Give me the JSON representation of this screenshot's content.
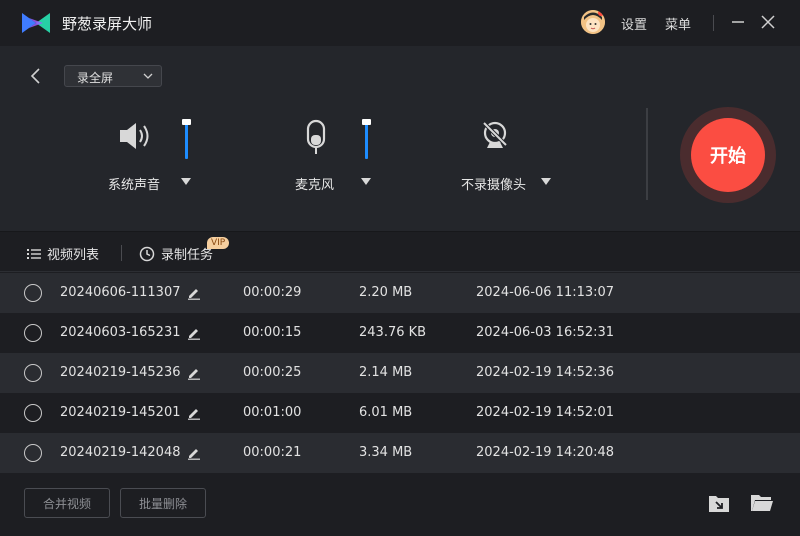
{
  "app": {
    "title": "野葱录屏大师"
  },
  "header": {
    "settings_label": "设置",
    "menu_label": "菜单"
  },
  "controls": {
    "mode": "录全屏",
    "system_audio": {
      "label": "系统声音",
      "volume": 1.0
    },
    "microphone": {
      "label": "麦克风",
      "volume": 1.0
    },
    "camera": {
      "label": "不录摄像头"
    },
    "start_label": "开始"
  },
  "tabs": {
    "video_list": "视频列表",
    "record_task": "录制任务",
    "vip": "VIP"
  },
  "recordings": [
    {
      "name": "20240606-111307",
      "duration": "00:00:29",
      "size": "2.20 MB",
      "date": "2024-06-06 11:13:07"
    },
    {
      "name": "20240603-165231",
      "duration": "00:00:15",
      "size": "243.76 KB",
      "date": "2024-06-03 16:52:31"
    },
    {
      "name": "20240219-145236",
      "duration": "00:00:25",
      "size": "2.14 MB",
      "date": "2024-02-19 14:52:36"
    },
    {
      "name": "20240219-145201",
      "duration": "00:01:00",
      "size": "6.01 MB",
      "date": "2024-02-19 14:52:01"
    },
    {
      "name": "20240219-142048",
      "duration": "00:00:21",
      "size": "3.34 MB",
      "date": "2024-02-19 14:20:48"
    }
  ],
  "footer": {
    "merge_label": "合并视频",
    "batch_delete_label": "批量删除"
  },
  "colors": {
    "accent": "#1e8dff",
    "start": "#fb4d42",
    "background": "#1d1e22",
    "panel": "#24262b"
  },
  "icons": [
    "app-logo-icon",
    "avatar-icon",
    "minimize-icon",
    "close-icon",
    "back-icon",
    "speaker-icon",
    "mic-icon",
    "camera-off-icon",
    "list-icon",
    "clock-icon",
    "edit-icon",
    "import-icon",
    "folder-icon"
  ]
}
